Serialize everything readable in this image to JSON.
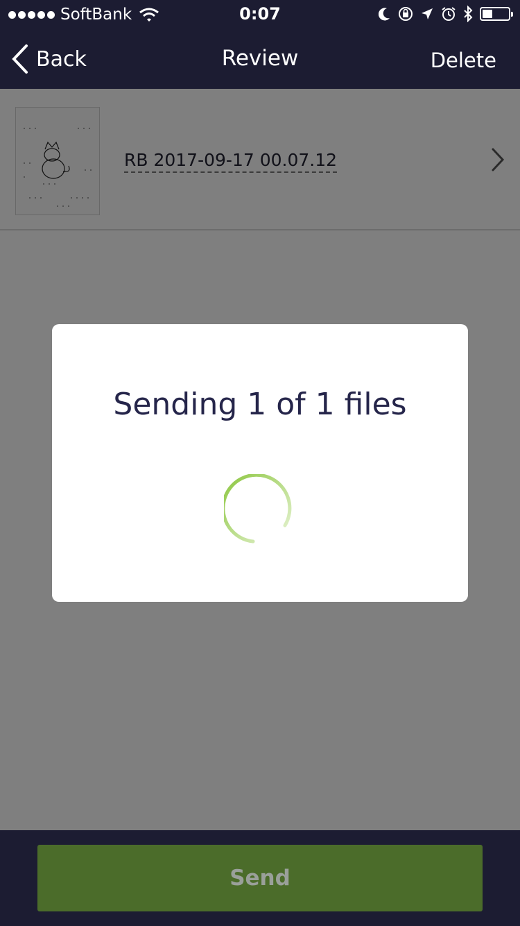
{
  "status_bar": {
    "carrier": "SoftBank",
    "time": "0:07",
    "signal_icon": "signal-dots-icon",
    "wifi_icon": "wifi-icon",
    "battery_level": 0.3
  },
  "nav": {
    "back_label": "Back",
    "title": "Review",
    "delete_label": "Delete"
  },
  "file": {
    "name": "RB 2017-09-17 00.07.12"
  },
  "modal": {
    "title": "Sending 1 of 1 files",
    "spinner_color": "#8cc63f"
  },
  "footer": {
    "send_label": "Send"
  },
  "colors": {
    "bar": "#1c1c32",
    "send_button": "#4b6c2a",
    "overlay": "rgba(0,0,0,0.5)"
  }
}
